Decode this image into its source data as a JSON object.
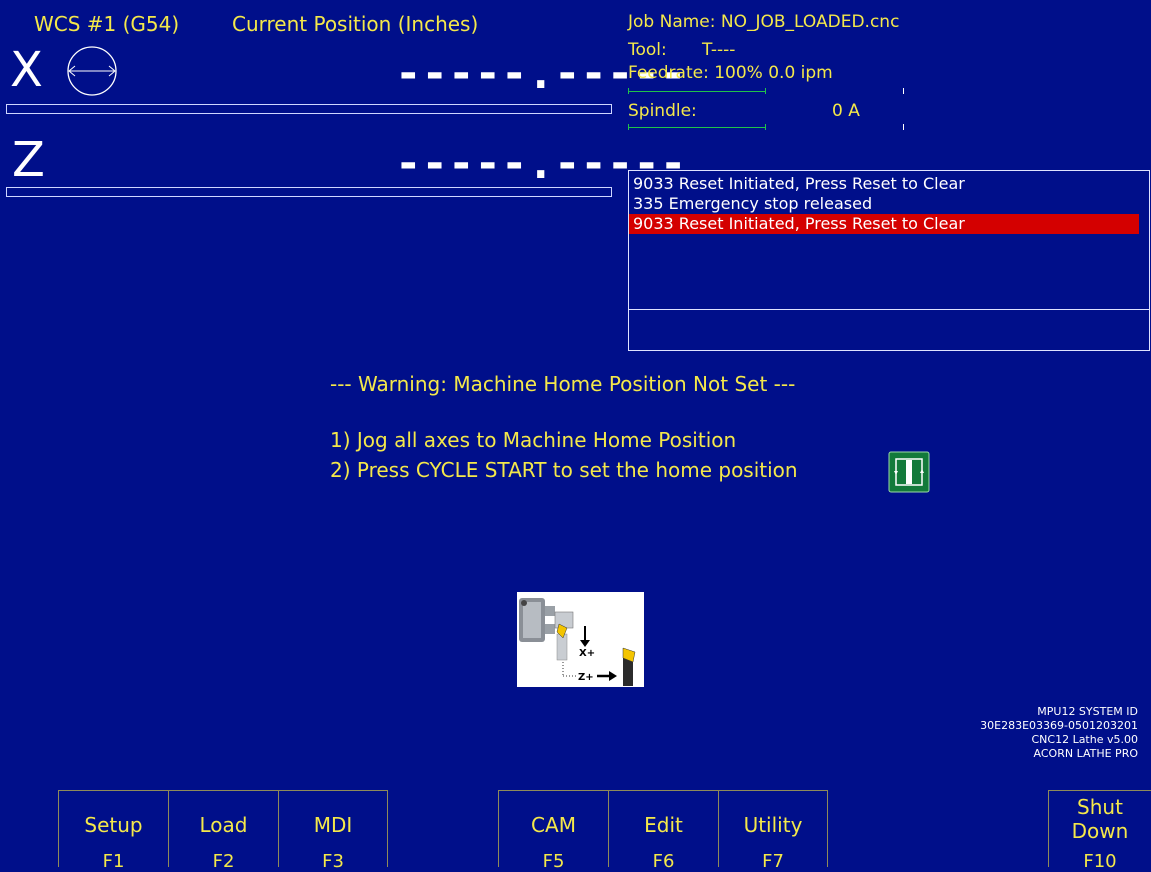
{
  "header": {
    "wcs": "WCS #1 (G54)",
    "position_title": "Current Position (Inches)"
  },
  "axes": [
    {
      "letter": "X",
      "value": "-----.-----"
    },
    {
      "letter": "Z",
      "value": "-----.-----"
    }
  ],
  "job": {
    "job_name": "Job Name: NO_JOB_LOADED.cnc",
    "tool_label": "Tool:",
    "tool_value": "T----",
    "feedrate": "Feedrate: 100%  0.0 ipm",
    "spindle_label": "Spindle:",
    "spindle_value": "0  A"
  },
  "messages": [
    {
      "text": "9033 Reset Initiated, Press Reset to Clear"
    },
    {
      "text": "335 Emergency stop released"
    },
    {
      "text": "9033 Reset Initiated, Press Reset to Clear",
      "highlighted": true
    }
  ],
  "warning": {
    "title": "--- Warning: Machine Home Position Not Set ---",
    "step1": "1) Jog all axes to Machine Home Position",
    "step2": "2) Press CYCLE START to set the home position"
  },
  "diagram": {
    "x_label": "X+",
    "z_label": "Z+"
  },
  "system": {
    "line1": "MPU12 SYSTEM ID",
    "line2": "30E283E03369-0501203201",
    "line3": "CNC12 Lathe v5.00",
    "line4": "ACORN LATHE PRO"
  },
  "function_keys": [
    {
      "label": "Setup",
      "key": "F1"
    },
    {
      "label": "Load",
      "key": "F2"
    },
    {
      "label": "MDI",
      "key": "F3"
    },
    {
      "label": "CAM",
      "key": "F5"
    },
    {
      "label": "Edit",
      "key": "F6"
    },
    {
      "label": "Utility",
      "key": "F7"
    },
    {
      "label_line1": "Shut",
      "label_line2": "Down",
      "key": "F10"
    }
  ],
  "colors": {
    "background": "#000f8a",
    "text_yellow": "#f4e84a",
    "highlight_red": "#d40000",
    "gauge_green": "#21c24a"
  },
  "icons": [
    "axis-diameter-icon",
    "cycle-start-icon",
    "lathe-jog-diagram"
  ]
}
